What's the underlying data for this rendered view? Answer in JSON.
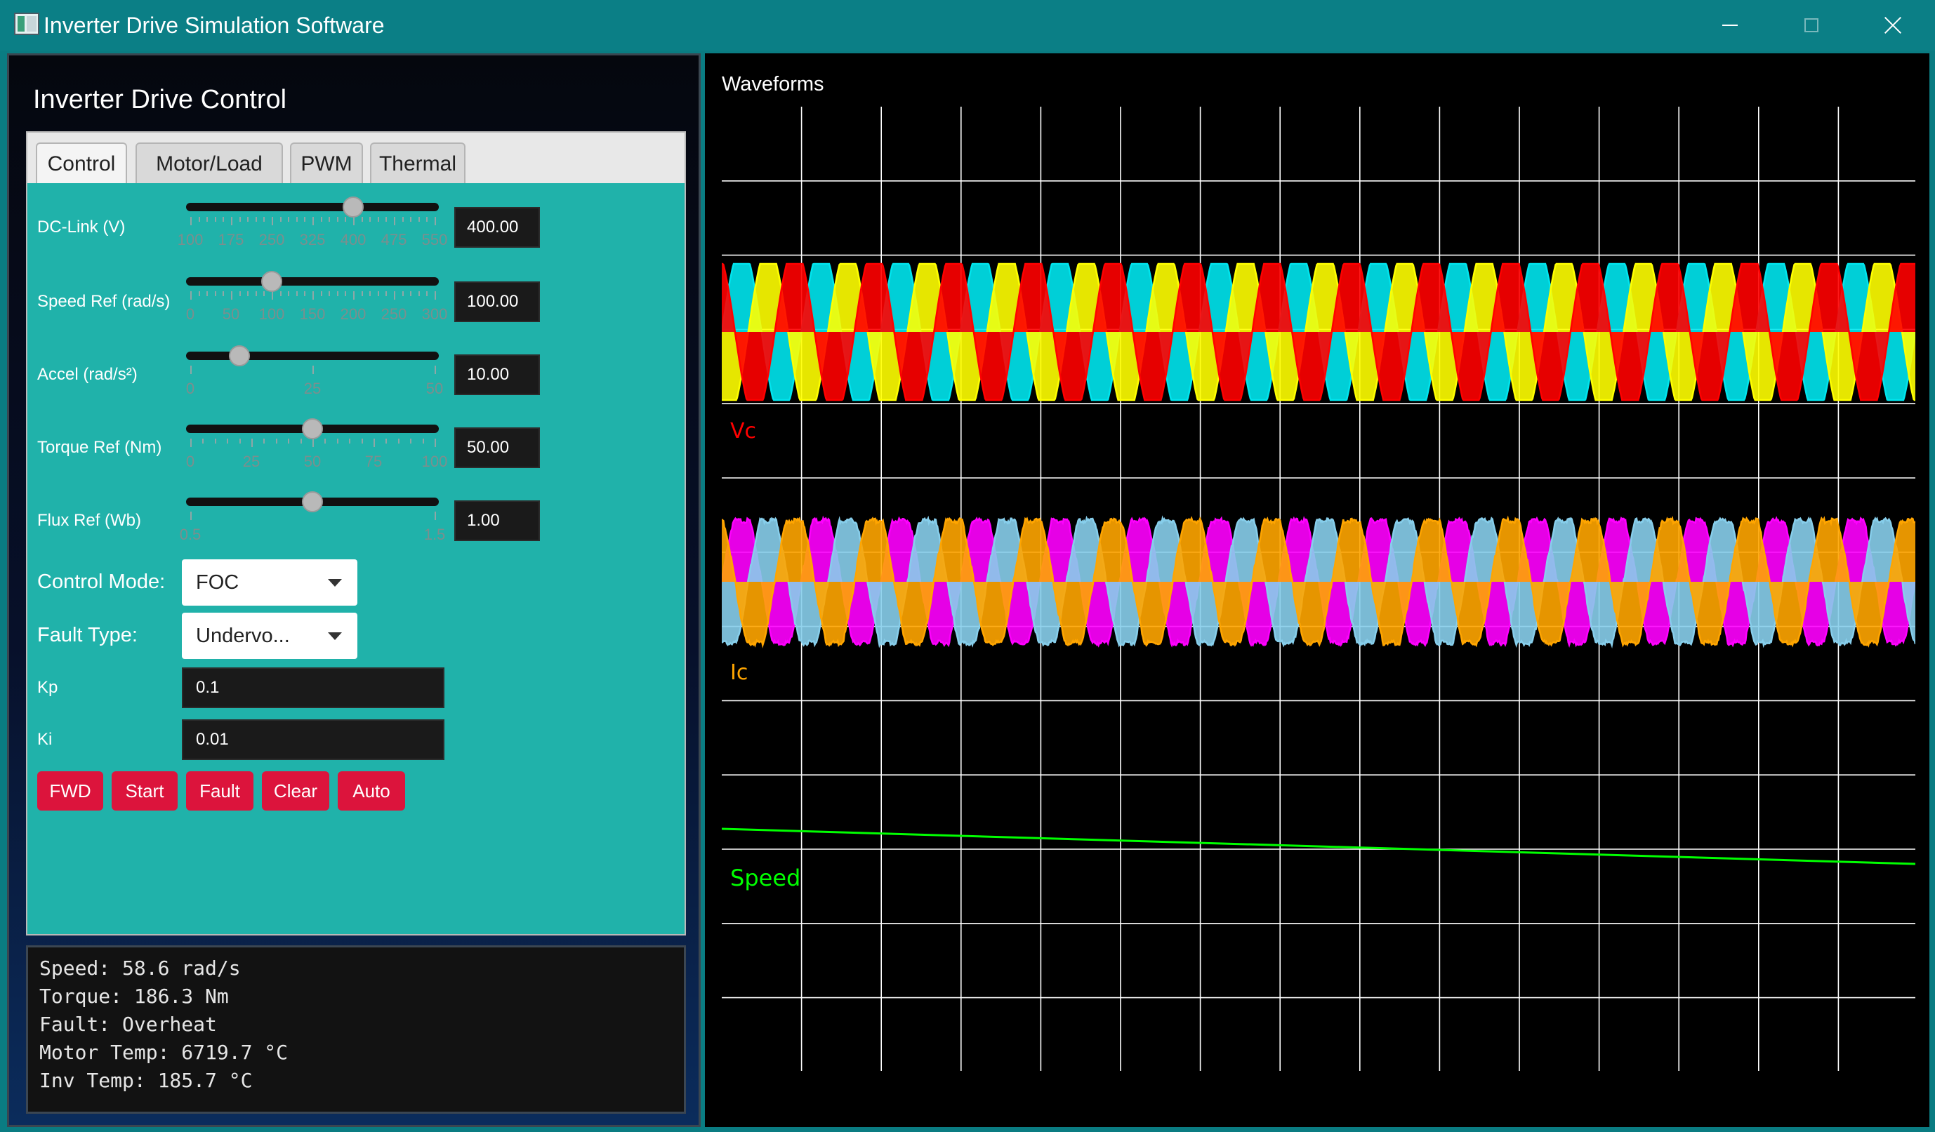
{
  "window": {
    "title": "Inverter Drive Simulation Software",
    "buttons": {
      "minimize": "minimize-icon",
      "maximize": "maximize-icon",
      "close": "close-icon"
    }
  },
  "panel": {
    "title": "Inverter Drive Control"
  },
  "tabs": [
    {
      "label": "Control",
      "active": true
    },
    {
      "label": "Motor/Load",
      "active": false
    },
    {
      "label": "PWM",
      "active": false
    },
    {
      "label": "Thermal",
      "active": false
    }
  ],
  "sliders": [
    {
      "label": "DC-Link (V)",
      "value_text": "400.00",
      "value": 400,
      "min": 100,
      "max": 550,
      "ticks": [
        "100",
        "175",
        "250",
        "325",
        "400",
        "475",
        "550"
      ]
    },
    {
      "label": "Speed Ref (rad/s)",
      "value_text": "100.00",
      "value": 100,
      "min": 0,
      "max": 300,
      "ticks": [
        "0",
        "50",
        "100",
        "150",
        "200",
        "250",
        "300"
      ]
    },
    {
      "label": "Accel (rad/s²)",
      "value_text": "10.00",
      "value": 10,
      "min": 0,
      "max": 50,
      "ticks": [
        "0",
        "25",
        "50"
      ]
    },
    {
      "label": "Torque Ref (Nm)",
      "value_text": "50.00",
      "value": 50,
      "min": 0,
      "max": 100,
      "ticks": [
        "0",
        "25",
        "50",
        "75",
        "100"
      ]
    },
    {
      "label": "Flux Ref (Wb)",
      "value_text": "1.00",
      "value": 1.0,
      "min": 0.5,
      "max": 1.5,
      "ticks": [
        "0.5",
        "1.5"
      ]
    }
  ],
  "control_mode": {
    "label": "Control Mode:",
    "value": "FOC"
  },
  "fault_type": {
    "label": "Fault Type:",
    "value": "Undervo..."
  },
  "kp": {
    "label": "Kp",
    "value": "0.1"
  },
  "ki": {
    "label": "Ki",
    "value": "0.01"
  },
  "action_buttons": [
    "FWD",
    "Start",
    "Fault",
    "Clear",
    "Auto"
  ],
  "status": [
    "Speed: 58.6 rad/s",
    "Torque: 186.3 Nm",
    "Fault: Overheat",
    "Motor Temp: 6719.7 °C",
    "Inv Temp: 185.7 °C"
  ],
  "waveforms": {
    "title": "Waveforms",
    "voltage_label": "Vc",
    "current_label": "Ic",
    "speed_label": "Speed",
    "colors": {
      "grid": "#ffffff",
      "va": "#00e5ee",
      "vb": "#ffff00",
      "vc": "#ff0000",
      "ia": "#ff00ff",
      "ib": "#87ceeb",
      "ic": "#ffa500",
      "speed": "#00ff00"
    },
    "speed_trend": {
      "start": 1.0,
      "end": 0.0
    }
  }
}
